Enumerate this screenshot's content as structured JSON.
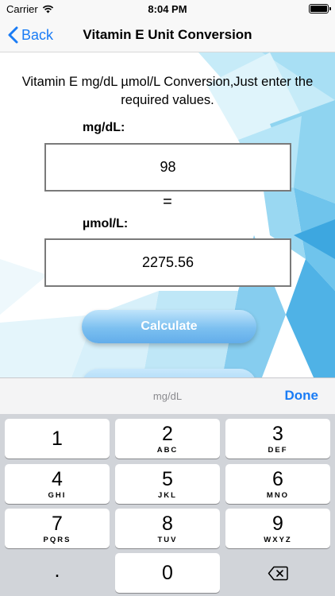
{
  "status_bar": {
    "carrier": "Carrier",
    "time": "8:04 PM",
    "battery_level": 1.0
  },
  "nav": {
    "back_label": "Back",
    "title": "Vitamin E Unit Conversion"
  },
  "main": {
    "instruction": "Vitamin E mg/dL µmol/L Conversion,Just enter the required values.",
    "input_label": "mg/dL:",
    "input_value": "98",
    "equals": "=",
    "result_label": "µmol/L:",
    "result_value": "2275.56",
    "calculate_label": "Calculate"
  },
  "keyboard": {
    "toolbar_placeholder": "mg/dL",
    "done_label": "Done",
    "keys": [
      {
        "digit": "1",
        "letters": ""
      },
      {
        "digit": "2",
        "letters": "ABC"
      },
      {
        "digit": "3",
        "letters": "DEF"
      },
      {
        "digit": "4",
        "letters": "GHI"
      },
      {
        "digit": "5",
        "letters": "JKL"
      },
      {
        "digit": "6",
        "letters": "MNO"
      },
      {
        "digit": "7",
        "letters": "PQRS"
      },
      {
        "digit": "8",
        "letters": "TUV"
      },
      {
        "digit": "9",
        "letters": "WXYZ"
      },
      {
        "digit": ".",
        "letters": ""
      },
      {
        "digit": "0",
        "letters": ""
      }
    ]
  },
  "colors": {
    "accent": "#1a7cf5",
    "button": "#7cc0f0",
    "keyboard_bg": "#d1d4d9"
  }
}
